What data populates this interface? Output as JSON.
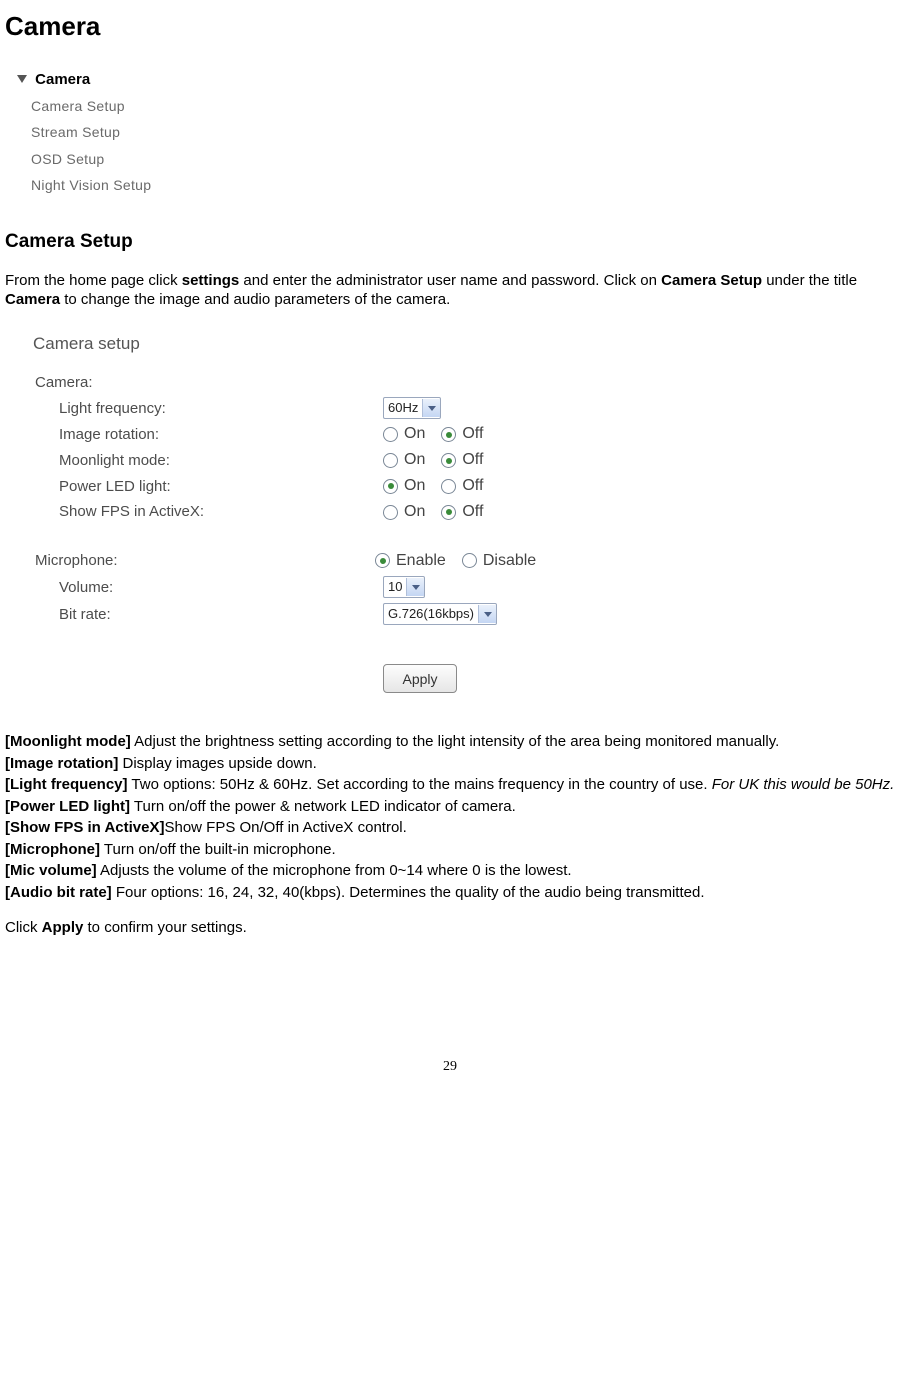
{
  "title": "Camera",
  "menu": {
    "header": "Camera",
    "items": [
      "Camera Setup",
      "Stream Setup",
      "OSD Setup",
      "Night Vision Setup"
    ]
  },
  "subtitle": "Camera Setup",
  "intro": {
    "t1": "From the home page click ",
    "b1": "settings",
    "t2": " and enter the administrator user name and password. Click on ",
    "b2": "Camera Setup",
    "t3": " under the title ",
    "b3": "Camera",
    "t4": " to change the image and audio parameters of the camera."
  },
  "setup": {
    "panel_title": "Camera setup",
    "section_camera": "Camera:",
    "light_freq_label": "Light frequency:",
    "light_freq_value": "60Hz",
    "img_rot_label": "Image rotation:",
    "moonlight_label": "Moonlight mode:",
    "power_led_label": "Power LED light:",
    "show_fps_label": "Show FPS in ActiveX:",
    "on": "On",
    "off": "Off",
    "section_mic": "Microphone:",
    "enable": "Enable",
    "disable": "Disable",
    "volume_label": "Volume:",
    "volume_value": "10",
    "bitrate_label": "Bit rate:",
    "bitrate_value": "G.726(16kbps)",
    "apply": "Apply"
  },
  "defs": {
    "d1_k": "[Moonlight mode]",
    "d1_v": " Adjust the brightness setting according to the light intensity of the area being monitored manually.",
    "d2_k": "[Image rotation]",
    "d2_v": " Display images upside down.",
    "d3_k": "[Light frequency]",
    "d3_v": " Two options: 50Hz & 60Hz. Set according to the mains frequency in the country of use. ",
    "d3_i": "For UK this would be 50Hz.",
    "d4_k": "[Power LED light]",
    "d4_v": " Turn on/off the power & network LED indicator of camera.",
    "d5_k": "[Show FPS in ActiveX]",
    "d5_v": "Show FPS On/Off in ActiveX control.",
    "d6_k": "[Microphone]",
    "d6_v": " Turn on/off the built-in microphone.",
    "d7_k": "[Mic volume]",
    "d7_v": " Adjusts the volume of the microphone from 0~14 where 0 is the lowest.",
    "d8_k": "[Audio bit rate]",
    "d8_v": " Four options: 16, 24, 32, 40(kbps). Determines the quality of the audio being transmitted."
  },
  "tail": {
    "t1": "Click ",
    "b1": "Apply",
    "t2": " to confirm your settings."
  },
  "page_num": "29"
}
